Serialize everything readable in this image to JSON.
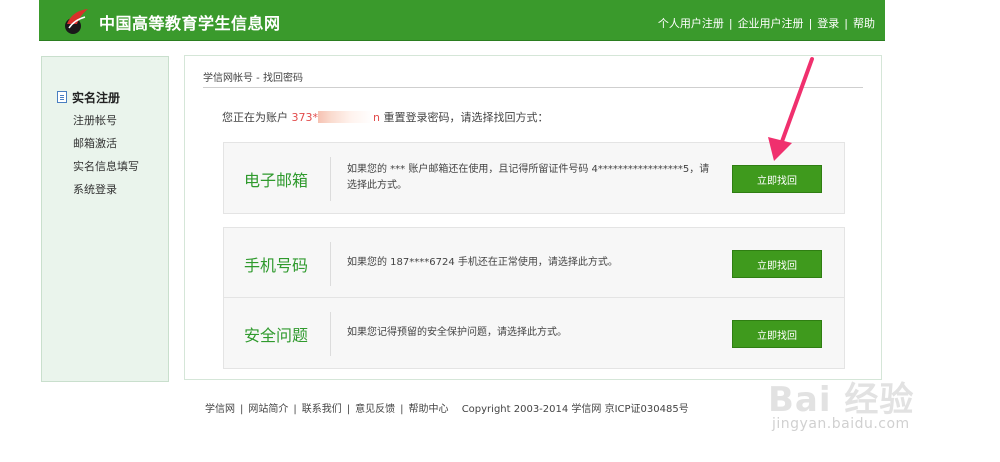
{
  "header": {
    "site_title": "中国高等教育学生信息网",
    "nav": [
      "个人用户注册",
      "企业用户注册",
      "登录",
      "帮助"
    ]
  },
  "sidebar": {
    "heading": "实名注册",
    "items": [
      "注册帐号",
      "邮箱激活",
      "实名信息填写",
      "系统登录"
    ]
  },
  "main": {
    "breadcrumb": "学信网帐号 - 找回密码",
    "intro_prefix": "您正在为账户",
    "account_start": "373*",
    "account_end": "n",
    "intro_suffix": "重置登录密码，请选择找回方式：",
    "options": [
      {
        "title": "电子邮箱",
        "desc": "如果您的 *** 账户邮箱还在使用，且记得所留证件号码 4*****************5，请选择此方式。",
        "button": "立即找回"
      },
      {
        "title": "手机号码",
        "desc": "如果您的 187****6724 手机还在正常使用，请选择此方式。",
        "button": "立即找回"
      },
      {
        "title": "安全问题",
        "desc": "如果您记得预留的安全保护问题，请选择此方式。",
        "button": "立即找回"
      }
    ]
  },
  "footer": {
    "links": [
      "学信网",
      "网站简介",
      "联系我们",
      "意见反馈",
      "帮助中心"
    ],
    "copyright": "Copyright 2003-2014 学信网 京ICP证030485号"
  },
  "watermark": {
    "line1": "Bai 经验",
    "line2": "jingyan.baidu.com"
  },
  "colors": {
    "header_bg": "#3a9a2c",
    "accent_green": "#2f9a2d",
    "button_bg": "#3f9a1d",
    "arrow": "#f0306e"
  }
}
